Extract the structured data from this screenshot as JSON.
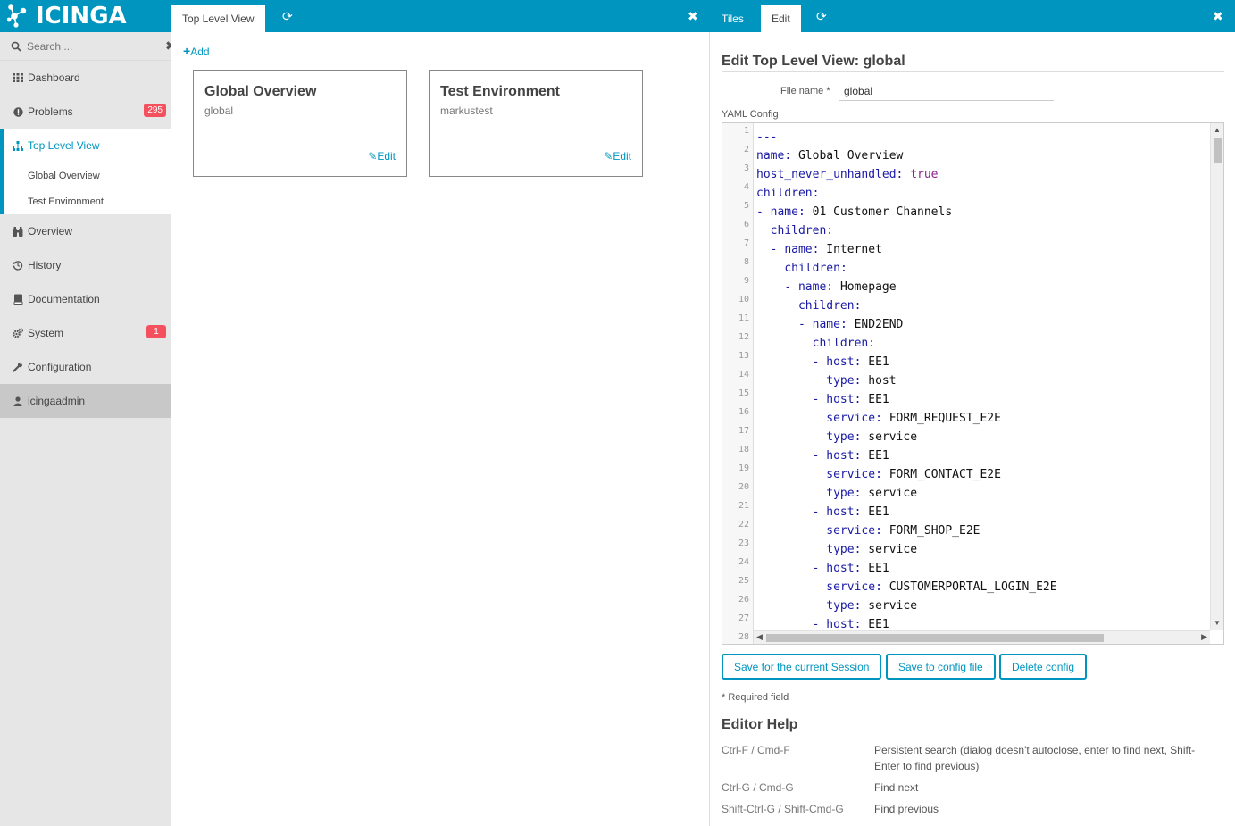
{
  "app": {
    "logo_text": "icinga",
    "accent_color": "#0095bf",
    "badge_color": "#f5505e"
  },
  "sidebar": {
    "search_placeholder": "Search ...",
    "items": [
      {
        "label": "Dashboard",
        "icon": "dashboard-icon"
      },
      {
        "label": "Problems",
        "icon": "warning-icon",
        "badge": "295"
      },
      {
        "label": "Top Level View",
        "icon": "sitemap-icon"
      },
      {
        "label": "Overview",
        "icon": "binoculars-icon"
      },
      {
        "label": "History",
        "icon": "history-icon"
      },
      {
        "label": "Documentation",
        "icon": "book-icon"
      },
      {
        "label": "System",
        "icon": "cogs-icon",
        "badge": "1"
      },
      {
        "label": "Configuration",
        "icon": "wrench-icon"
      },
      {
        "label": "icingaadmin",
        "icon": "user-icon"
      }
    ],
    "subitems": [
      "Global Overview",
      "Test Environment"
    ]
  },
  "header": {
    "left_tab": "Top Level View",
    "right_tabs": [
      "Tiles",
      "Edit"
    ]
  },
  "tiles_view": {
    "add_label": "Add",
    "tiles": [
      {
        "title": "Global Overview",
        "subtitle": "global",
        "edit_label": "Edit"
      },
      {
        "title": "Test Environment",
        "subtitle": "markustest",
        "edit_label": "Edit"
      }
    ]
  },
  "edit_form": {
    "title": "Edit Top Level View: global",
    "file_name_label": "File name *",
    "file_name_value": "global",
    "yaml_label": "YAML Config",
    "line_numbers": [
      "1",
      "2",
      "3",
      "4",
      "5",
      "6",
      "7",
      "8",
      "9",
      "10",
      "11",
      "12",
      "13",
      "14",
      "15",
      "16",
      "17",
      "18",
      "19",
      "20",
      "21",
      "22",
      "23",
      "24",
      "25",
      "26",
      "27",
      "28"
    ],
    "code_lines": [
      {
        "indent": "",
        "dash": false,
        "key": "",
        "value": "---"
      },
      {
        "indent": "",
        "dash": false,
        "key": "name",
        "value": "Global Overview"
      },
      {
        "indent": "",
        "dash": false,
        "key": "host_never_unhandled",
        "value": "true",
        "atom": true
      },
      {
        "indent": "",
        "dash": false,
        "key": "children",
        "value": ""
      },
      {
        "indent": "",
        "dash": true,
        "key": "name",
        "value": "01 Customer Channels"
      },
      {
        "indent": "  ",
        "dash": false,
        "key": "children",
        "value": ""
      },
      {
        "indent": "  ",
        "dash": true,
        "key": "name",
        "value": "Internet"
      },
      {
        "indent": "    ",
        "dash": false,
        "key": "children",
        "value": ""
      },
      {
        "indent": "    ",
        "dash": true,
        "key": "name",
        "value": "Homepage"
      },
      {
        "indent": "      ",
        "dash": false,
        "key": "children",
        "value": ""
      },
      {
        "indent": "      ",
        "dash": true,
        "key": "name",
        "value": "END2END"
      },
      {
        "indent": "        ",
        "dash": false,
        "key": "children",
        "value": ""
      },
      {
        "indent": "        ",
        "dash": true,
        "key": "host",
        "value": "EE1"
      },
      {
        "indent": "          ",
        "dash": false,
        "key": "type",
        "value": "host"
      },
      {
        "indent": "        ",
        "dash": true,
        "key": "host",
        "value": "EE1"
      },
      {
        "indent": "          ",
        "dash": false,
        "key": "service",
        "value": "FORM_REQUEST_E2E"
      },
      {
        "indent": "          ",
        "dash": false,
        "key": "type",
        "value": "service"
      },
      {
        "indent": "        ",
        "dash": true,
        "key": "host",
        "value": "EE1"
      },
      {
        "indent": "          ",
        "dash": false,
        "key": "service",
        "value": "FORM_CONTACT_E2E"
      },
      {
        "indent": "          ",
        "dash": false,
        "key": "type",
        "value": "service"
      },
      {
        "indent": "        ",
        "dash": true,
        "key": "host",
        "value": "EE1"
      },
      {
        "indent": "          ",
        "dash": false,
        "key": "service",
        "value": "FORM_SHOP_E2E"
      },
      {
        "indent": "          ",
        "dash": false,
        "key": "type",
        "value": "service"
      },
      {
        "indent": "        ",
        "dash": true,
        "key": "host",
        "value": "EE1"
      },
      {
        "indent": "          ",
        "dash": false,
        "key": "service",
        "value": "CUSTOMERPORTAL_LOGIN_E2E"
      },
      {
        "indent": "          ",
        "dash": false,
        "key": "type",
        "value": "service"
      },
      {
        "indent": "        ",
        "dash": true,
        "key": "host",
        "value": "EE1"
      }
    ],
    "buttons": [
      "Save for the current Session",
      "Save to config file",
      "Delete config"
    ],
    "required_note": "* Required field"
  },
  "editor_help": {
    "title": "Editor Help",
    "rows": [
      {
        "key": "Ctrl-F / Cmd-F",
        "desc": "Persistent search (dialog doesn't autoclose, enter to find next, Shift-Enter to find previous)"
      },
      {
        "key": "Ctrl-G / Cmd-G",
        "desc": "Find next"
      },
      {
        "key": "Shift-Ctrl-G / Shift-Cmd-G",
        "desc": "Find previous"
      }
    ]
  }
}
